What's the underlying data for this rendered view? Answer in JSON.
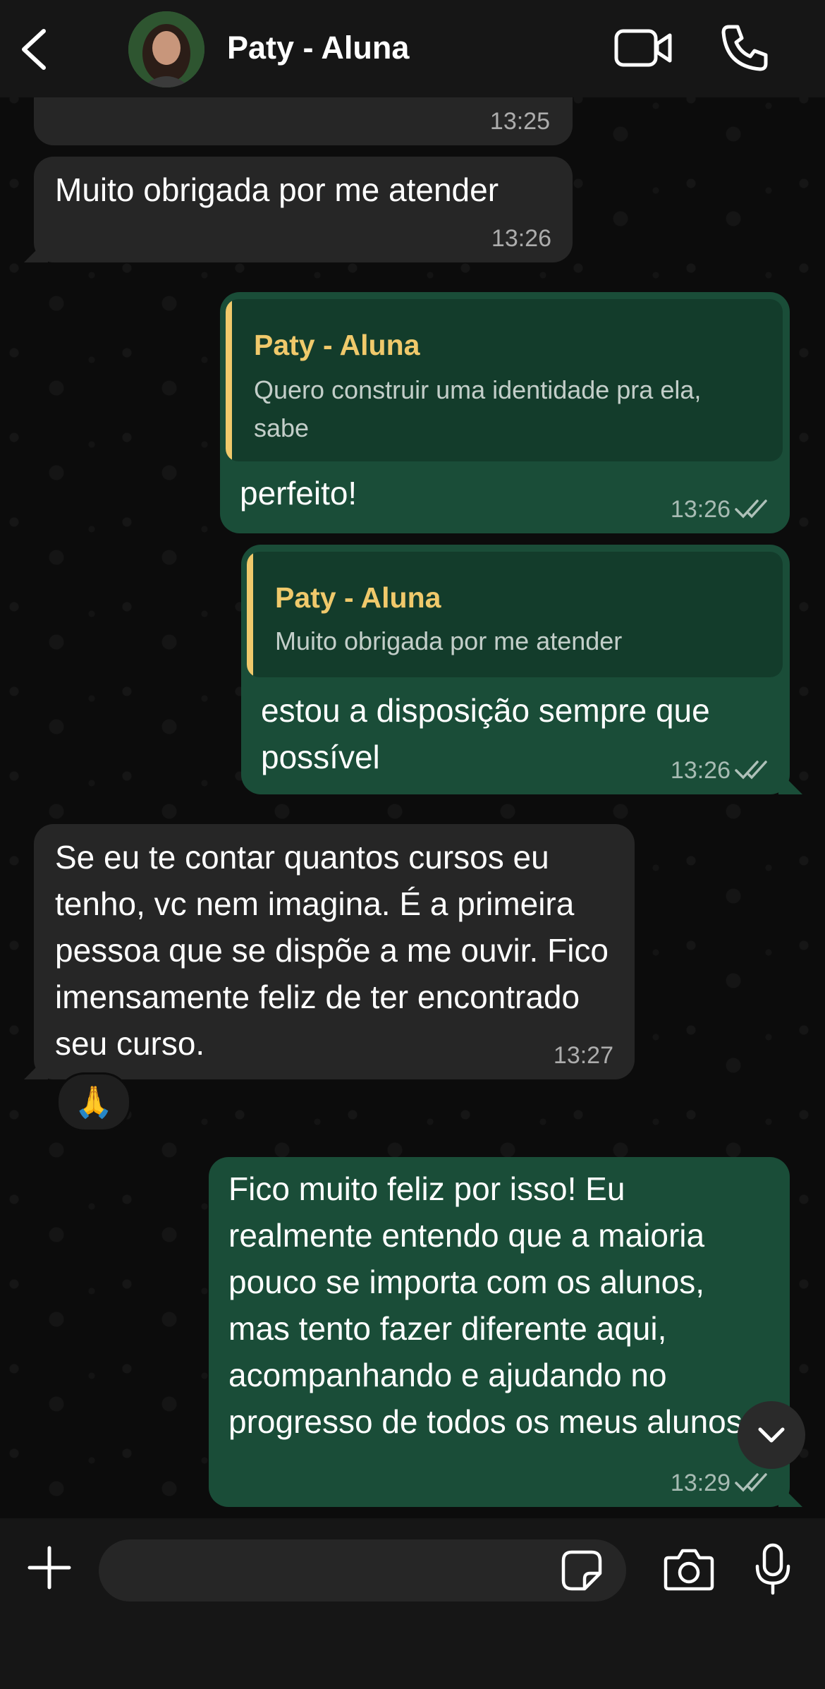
{
  "header": {
    "contact_name": "Paty - Aluna",
    "icons": [
      "back-icon",
      "avatar",
      "video-call-icon",
      "voice-call-icon"
    ]
  },
  "messages": [
    {
      "direction": "in",
      "text": "",
      "time": "13:25"
    },
    {
      "direction": "in",
      "text": "Muito obrigada por me atender",
      "time": "13:26"
    },
    {
      "direction": "out",
      "quote_author": "Paty - Aluna",
      "quote_text": "Quero construir uma identidade pra ela, sabe",
      "text": "perfeito!",
      "time": "13:26",
      "status": "read"
    },
    {
      "direction": "out",
      "quote_author": "Paty - Aluna",
      "quote_text": "Muito obrigada por me atender",
      "text": "estou a disposição sempre que possível",
      "time": "13:26",
      "status": "read"
    },
    {
      "direction": "in",
      "text": "Se eu te contar quantos cursos eu tenho, vc nem imagina. É a primeira pessoa que se dispõe a me ouvir. Fico imensamente feliz de ter encontrado seu curso.",
      "time": "13:27",
      "reaction": "🙏"
    },
    {
      "direction": "out",
      "text": "Fico muito feliz por isso! Eu realmente entendo que a maioria pouco se importa com os alunos, mas tento fazer diferente aqui, acompanhando e ajudando no progresso de todos os meus alunos",
      "time": "13:29",
      "status": "read"
    }
  ],
  "input": {
    "value": "",
    "placeholder": "",
    "icons": [
      "plus-icon",
      "sticker-icon",
      "camera-icon",
      "microphone-icon"
    ]
  },
  "colors": {
    "header_bg": "#161616",
    "incoming_bubble": "#262626",
    "outgoing_bubble": "#1a4d38",
    "quote_accent": "#f0c96b",
    "quote_bg": "#133c2b"
  }
}
